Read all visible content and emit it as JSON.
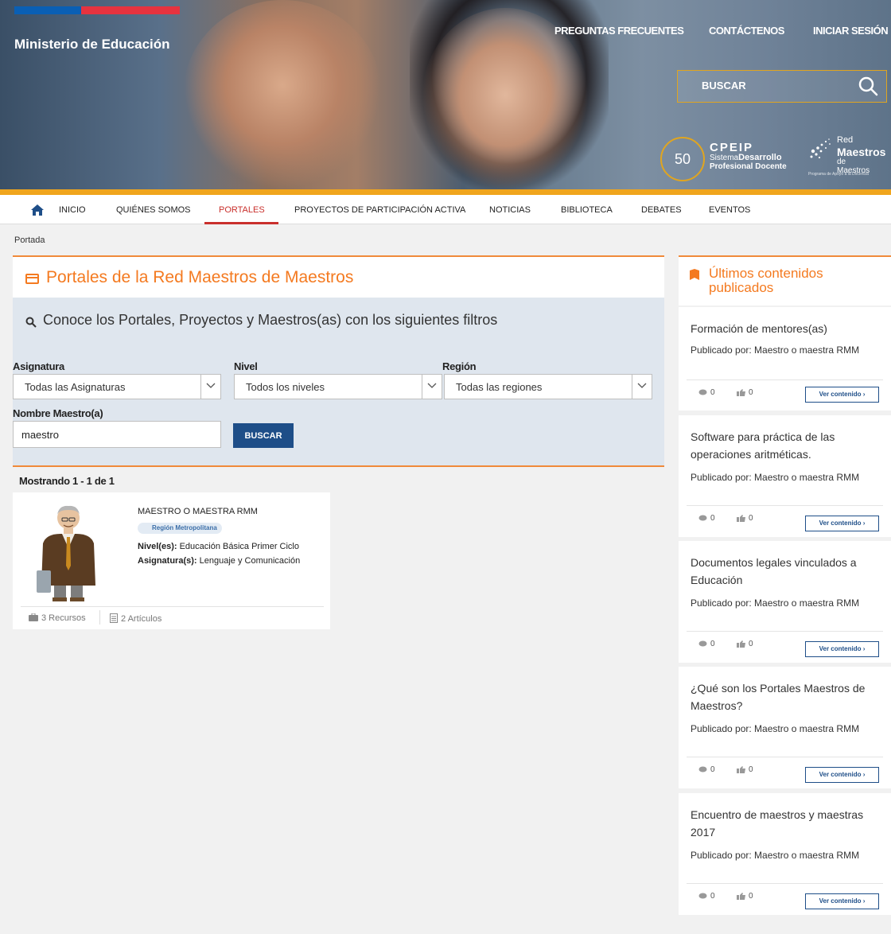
{
  "header": {
    "ministry": "Ministerio de Educación",
    "links": {
      "faq": "PREGUNTAS FRECUENTES",
      "contact": "CONTÁCTENOS",
      "login": "INICIAR SESIÓN"
    },
    "search_placeholder": "BUSCAR",
    "badge": "50",
    "cpeip": {
      "name": "CPEIP",
      "line2_a": "Sistema",
      "line2_b": "Desarrollo",
      "line3": "Profesional Docente"
    },
    "rmm": {
      "red": "Red",
      "maestros": "Maestros",
      "de_maestros": "de Maestros",
      "program": "Programa de Apoyo a la Docencia"
    },
    "colors": {
      "accent": "#f0a51d",
      "flag_blue": "#0a5fb4",
      "flag_red": "#e6333f"
    }
  },
  "nav": {
    "items": [
      "INICIO",
      "QUIÉNES SOMOS",
      "PORTALES",
      "PROYECTOS DE PARTICIPACIÓN ACTIVA",
      "NOTICIAS",
      "BIBLIOTECA",
      "DEBATES",
      "EVENTOS"
    ],
    "active": "PORTALES"
  },
  "breadcrumb": "Portada",
  "main": {
    "title": "Portales de la Red Maestros de Maestros",
    "filters_heading": "Conoce los Portales, Proyectos y Maestros(as) con los siguientes filtros",
    "asignatura_label": "Asignatura",
    "asignatura_value": "Todas las Asignaturas",
    "nivel_label": "Nivel",
    "nivel_value": "Todos los niveles",
    "region_label": "Región",
    "region_value": "Todas las regiones",
    "nombre_label": "Nombre Maestro(a)",
    "nombre_value": "maestro",
    "buscar": "BUSCAR",
    "results_count": "Mostrando 1 - 1 de 1",
    "profile": {
      "name": "MAESTRO O MAESTRA RMM",
      "region": "Región Metropolitana",
      "nivel_label": "Nivel(es):",
      "nivel_value": "Educación Básica Primer Ciclo",
      "asignatura_label": "Asignatura(s):",
      "asignatura_value": "Lenguaje y Comunicación",
      "recursos": "3 Recursos",
      "articulos": "2 Artículos"
    },
    "colors": {
      "title_orange": "#f47a20",
      "button_blue": "#1e4e88"
    }
  },
  "sidebar": {
    "heading": "Últimos contenidos publicados",
    "posts": [
      {
        "title": "Formación de mentores(as)",
        "by": "Publicado por: Maestro o maestra RMM",
        "comments": "0",
        "likes": "0",
        "cta": "Ver contenido ›"
      },
      {
        "title": "Software para práctica de las operaciones aritméticas.",
        "by": "Publicado por: Maestro o maestra RMM",
        "comments": "0",
        "likes": "0",
        "cta": "Ver contenido ›"
      },
      {
        "title": "Documentos legales vinculados a Educación",
        "by": "Publicado por: Maestro o maestra RMM",
        "comments": "0",
        "likes": "0",
        "cta": "Ver contenido ›"
      },
      {
        "title": "¿Qué son los Portales Maestros de Maestros?",
        "by": "Publicado por: Maestro o maestra RMM",
        "comments": "0",
        "likes": "0",
        "cta": "Ver contenido ›"
      },
      {
        "title": "Encuentro de maestros y maestras 2017",
        "by": "Publicado por: Maestro o maestra RMM",
        "comments": "0",
        "likes": "0",
        "cta": "Ver contenido ›"
      }
    ]
  }
}
